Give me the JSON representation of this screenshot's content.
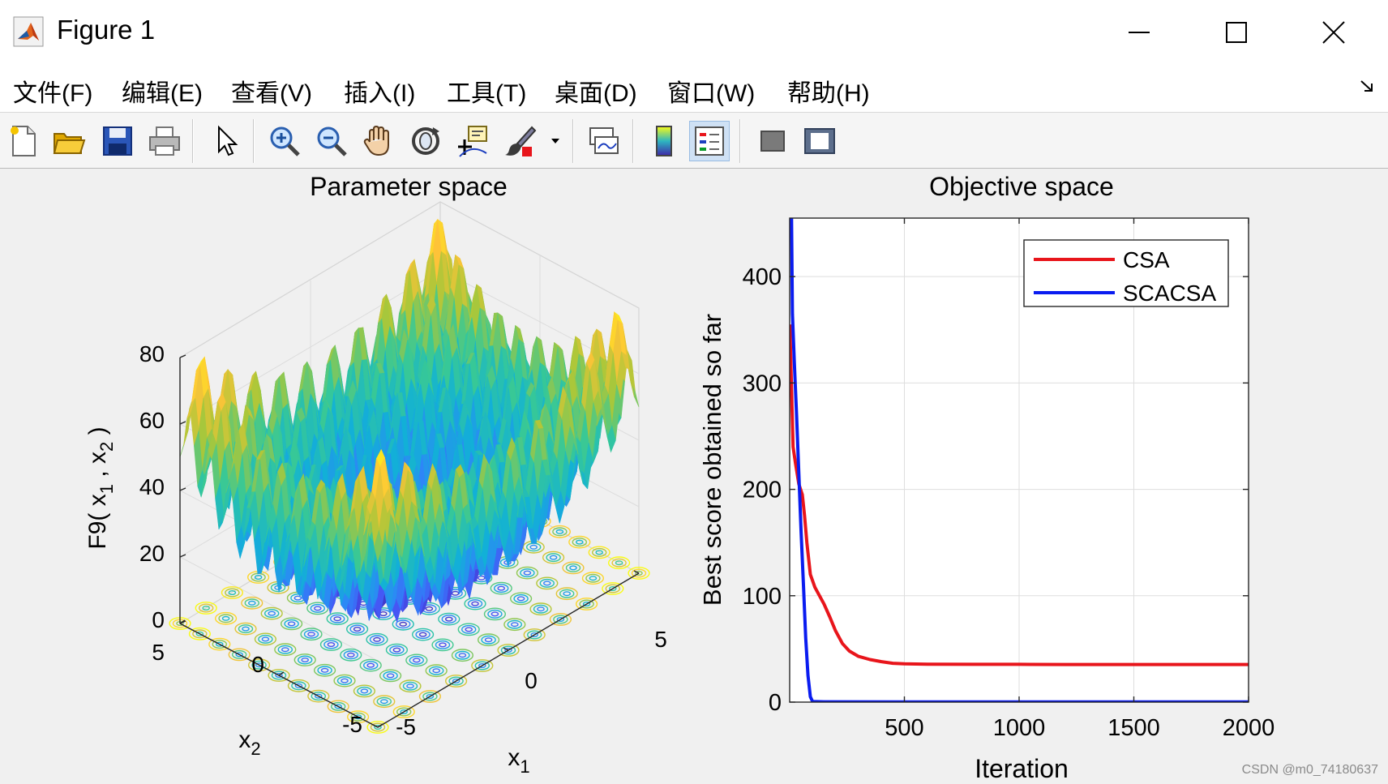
{
  "window": {
    "title": "Figure 1"
  },
  "menu": [
    {
      "label": "文件(F)",
      "key": "file"
    },
    {
      "label": "编辑(E)",
      "key": "edit"
    },
    {
      "label": "查看(V)",
      "key": "view"
    },
    {
      "label": "插入(I)",
      "key": "insert"
    },
    {
      "label": "工具(T)",
      "key": "tools"
    },
    {
      "label": "桌面(D)",
      "key": "desktop"
    },
    {
      "label": "窗口(W)",
      "key": "window"
    },
    {
      "label": "帮助(H)",
      "key": "help"
    }
  ],
  "toolbar": {
    "icons": [
      "new-figure-icon",
      "open-file-icon",
      "save-icon",
      "print-icon",
      "select-arrow-icon",
      "zoom-in-icon",
      "zoom-out-icon",
      "pan-hand-icon",
      "rotate-3d-icon",
      "data-cursor-icon",
      "brush-icon",
      "brush-dropdown-icon",
      "link-plot-icon",
      "colorbar-icon",
      "legend-icon",
      "hide-plot-tools-icon",
      "show-plot-tools-icon"
    ]
  },
  "chart_data": [
    {
      "type": "surface",
      "title": "Parameter space",
      "xlabel": "x1",
      "ylabel": "x2",
      "zlabel": "F9( x1 , x2 )",
      "function": "Rastrigin: sum(x_i^2 - 10 cos(2 pi x_i)) + 20",
      "x_ticks": [
        "-5",
        "0",
        "5"
      ],
      "y_ticks": [
        "-5",
        "0",
        "5"
      ],
      "z_ticks": [
        "0",
        "20",
        "40",
        "60",
        "80"
      ],
      "xlim": [
        -5,
        5
      ],
      "ylim": [
        -5,
        5
      ],
      "zlim": [
        0,
        80
      ],
      "contour_at_base": true,
      "colormap": "parula"
    },
    {
      "type": "line",
      "title": "Objective space",
      "xlabel": "Iteration",
      "ylabel": "Best score obtained so far",
      "xlim": [
        0,
        2000
      ],
      "ylim": [
        0,
        455
      ],
      "x_ticks": [
        500,
        1000,
        1500,
        2000
      ],
      "y_ticks": [
        0,
        100,
        200,
        300,
        400
      ],
      "grid": true,
      "legend_position": "top-right",
      "series": [
        {
          "name": "CSA",
          "color": "#e8151b",
          "x": [
            1,
            5,
            15,
            25,
            40,
            55,
            65,
            75,
            90,
            110,
            130,
            150,
            175,
            200,
            230,
            260,
            300,
            350,
            400,
            450,
            500,
            600,
            800,
            1000,
            1200,
            1500,
            1800,
            2000
          ],
          "y": [
            355,
            320,
            240,
            225,
            205,
            195,
            175,
            150,
            120,
            108,
            100,
            92,
            80,
            67,
            55,
            48,
            43,
            40,
            38,
            36.5,
            36,
            35.7,
            35.5,
            35.5,
            35.4,
            35.4,
            35.4,
            35.4
          ]
        },
        {
          "name": "SCACSA",
          "color": "#0a1cf0",
          "x": [
            1,
            8,
            12,
            20,
            30,
            40,
            50,
            60,
            70,
            80,
            90,
            100,
            150,
            500,
            1000,
            1500,
            2000
          ],
          "y": [
            455,
            455,
            365,
            320,
            270,
            215,
            160,
            110,
            60,
            25,
            5,
            0.5,
            0.3,
            0.2,
            0.2,
            0.2,
            0.2
          ]
        }
      ]
    }
  ],
  "watermark": "CSDN @m0_74180637"
}
